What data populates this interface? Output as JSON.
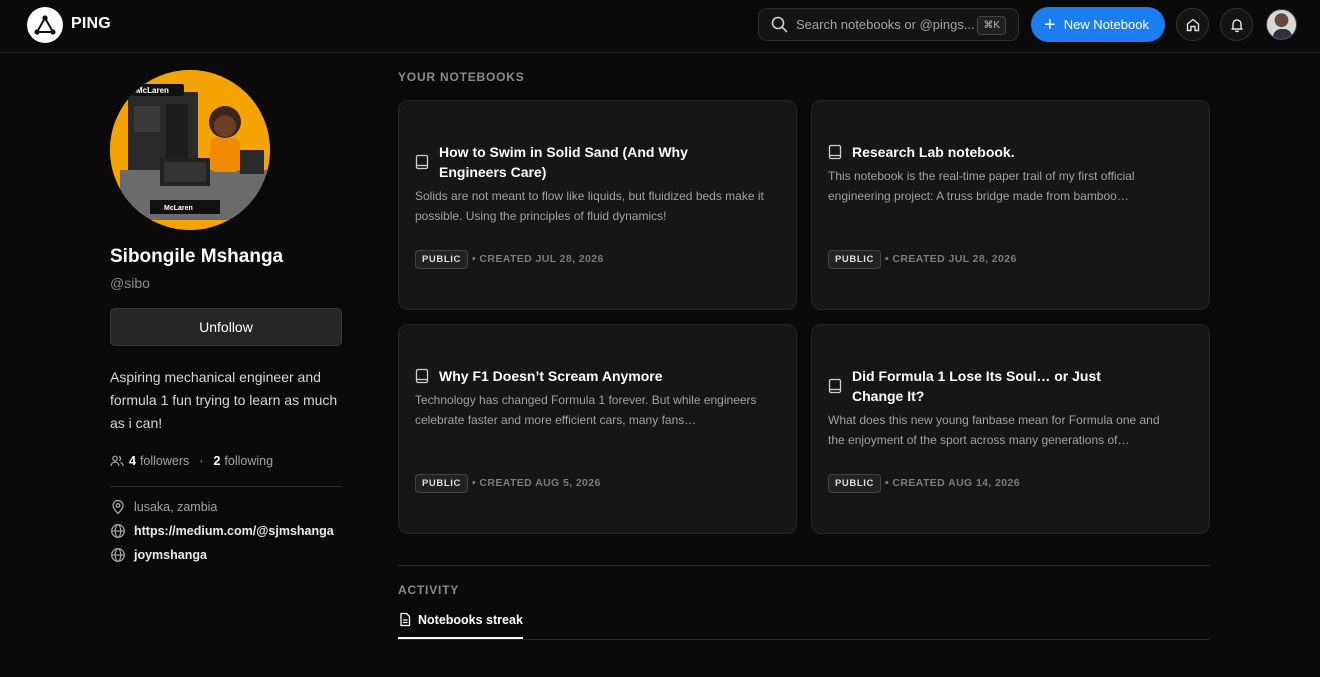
{
  "app": {
    "brand": "PING",
    "search_placeholder": "Search notebooks or @pings...",
    "search_shortcut": "⌘K",
    "new_notebook_label": "New Notebook",
    "accent": "#1a7df0"
  },
  "profile": {
    "name": "Sibongile Mshanga",
    "handle": "@sibo",
    "action_label": "Unfollow",
    "bio": "Aspiring mechanical engineer and formula 1 fun trying to learn as much as i can!",
    "followers_count": "4",
    "followers_label": "followers",
    "following_count": "2",
    "following_label": "following",
    "location": "lusaka, zambia",
    "website": "https://medium.com/@sjmshanga",
    "social": "joymshanga"
  },
  "notebooks": {
    "section_title": "YOUR NOTEBOOKS",
    "items": [
      {
        "title": "How to Swim in Solid Sand (And Why Engineers Care)",
        "description": "Solids are not meant to flow like liquids, but fluidized beds make it possible. Using the principles of fluid dynamics!",
        "visibility": "PUBLIC",
        "created": "• CREATED JUL 28, 2026"
      },
      {
        "title": "Research Lab notebook.",
        "description": "This notebook is the real-time paper trail of my first official engineering project: A truss bridge made from bamboo…",
        "visibility": "PUBLIC",
        "created": "• CREATED JUL 28, 2026"
      },
      {
        "title": "Why F1 Doesn’t Scream Anymore",
        "description": "Technology has changed Formula 1 forever. But while engineers celebrate faster and more efficient cars, many fans…",
        "visibility": "PUBLIC",
        "created": "• CREATED AUG 5, 2026"
      },
      {
        "title": "Did Formula 1 Lose Its Soul… or Just Change It?",
        "description": "What does this new young fanbase mean for Formula one and the enjoyment of the sport across many generations of…",
        "visibility": "PUBLIC",
        "created": "• CREATED AUG 14, 2026"
      }
    ]
  },
  "activity": {
    "section_title": "ACTIVITY",
    "tab_label": "Notebooks streak"
  }
}
